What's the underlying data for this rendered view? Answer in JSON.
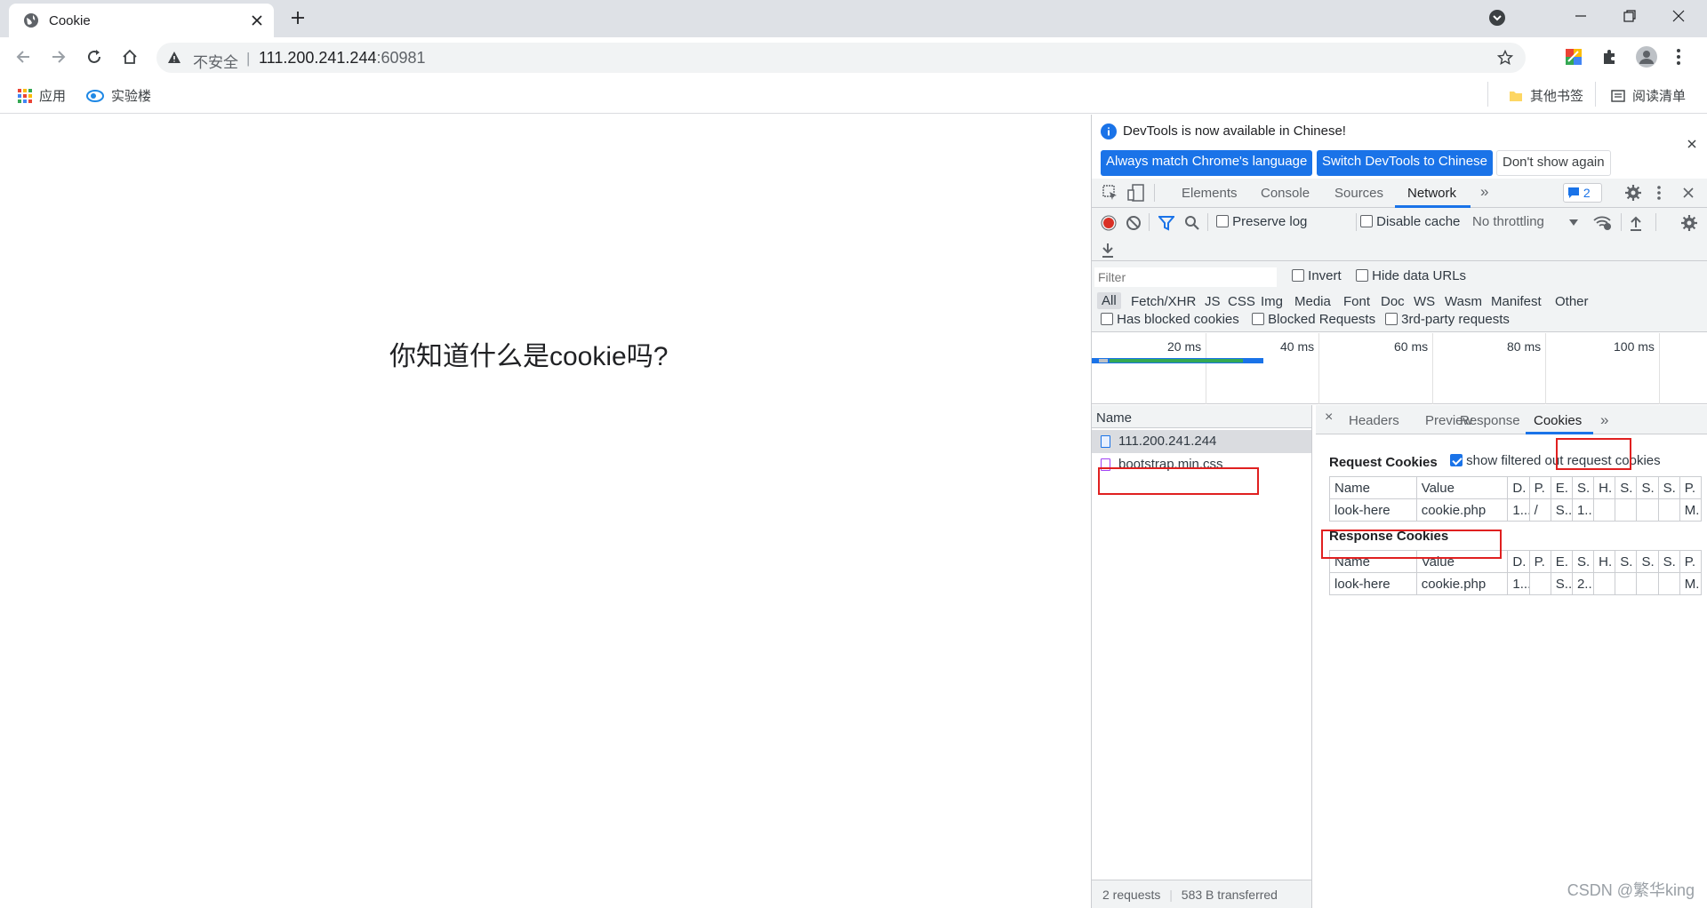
{
  "browser": {
    "tab_title": "Cookie",
    "url_insecure_label": "不安全",
    "url_separator": "|",
    "url_host": "111.200.241.244",
    "url_port": ":60981"
  },
  "bookmarks": {
    "apps": "应用",
    "shiyanlou": "实验楼",
    "other_bookmarks": "其他书签",
    "reading_list": "阅读清单"
  },
  "page": {
    "question": "你知道什么是cookie吗?"
  },
  "devtools": {
    "infobar": {
      "message": "DevTools is now available in Chinese!",
      "btn_match": "Always match Chrome's language",
      "btn_switch": "Switch DevTools to Chinese",
      "btn_dismiss": "Don't show again"
    },
    "tabs": [
      "Elements",
      "Console",
      "Sources",
      "Network"
    ],
    "more_tabs": "»",
    "issues_count": "2",
    "toolbar": {
      "preserve_log": "Preserve log",
      "disable_cache": "Disable cache",
      "throttling": "No throttling"
    },
    "filter": {
      "placeholder": "Filter",
      "invert": "Invert",
      "hide_data_urls": "Hide data URLs",
      "types": [
        "All",
        "Fetch/XHR",
        "JS",
        "CSS",
        "Img",
        "Media",
        "Font",
        "Doc",
        "WS",
        "Wasm",
        "Manifest",
        "Other"
      ],
      "has_blocked_cookies": "Has blocked cookies",
      "blocked_requests": "Blocked Requests",
      "third_party": "3rd-party requests"
    },
    "timeline": {
      "labels": [
        "20 ms",
        "40 ms",
        "60 ms",
        "80 ms",
        "100 ms"
      ]
    },
    "requests": {
      "header": "Name",
      "items": [
        "111.200.241.244",
        "bootstrap.min.css"
      ],
      "footer_count": "2 requests",
      "footer_transferred": "583 B transferred"
    },
    "detail": {
      "close": "×",
      "tabs": [
        "Headers",
        "Preview",
        "Response",
        "Cookies"
      ],
      "more": "»",
      "request_cookies_title": "Request Cookies",
      "show_filtered": "show filtered out request cookies",
      "columns": [
        "Name",
        "Value",
        "D.",
        "P.",
        "E.",
        "S.",
        "H.",
        "S.",
        "S.",
        "S.",
        "P."
      ],
      "request_rows": [
        [
          "look-here",
          "cookie.php",
          "1...",
          "/",
          "S...",
          "1...",
          "",
          "",
          "",
          "",
          "M."
        ]
      ],
      "response_cookies_title": "Response Cookies",
      "response_rows": [
        [
          "look-here",
          "cookie.php",
          "1...",
          "",
          "S...",
          "2...",
          "",
          "",
          "",
          "",
          "M."
        ]
      ]
    }
  },
  "watermark": "CSDN @繁华king",
  "colors": {
    "accent": "#1a73e8",
    "record": "#d93025",
    "highlight_box": "#e02020"
  }
}
